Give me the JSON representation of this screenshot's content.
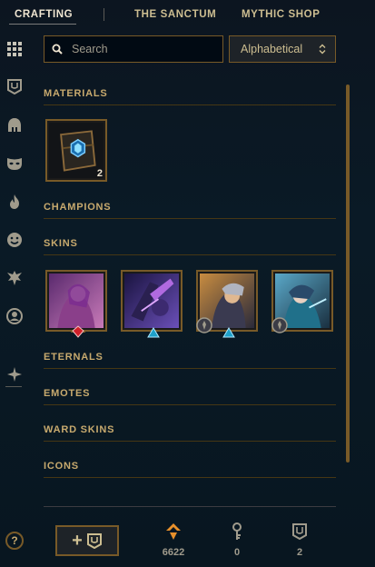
{
  "nav": {
    "tabs": [
      {
        "label": "CRAFTING",
        "active": true
      },
      {
        "label": "THE SANCTUM",
        "active": false
      },
      {
        "label": "MYTHIC SHOP",
        "active": false
      }
    ]
  },
  "sidebar": {
    "icons": [
      "grid-icon",
      "chest-icon",
      "helmet-icon",
      "mask-icon",
      "flame-icon",
      "emote-face-icon",
      "ward-icon",
      "profile-icon",
      "eternals-icon"
    ]
  },
  "search": {
    "placeholder": "Search",
    "value": ""
  },
  "sort": {
    "selected": "Alphabetical"
  },
  "sections": {
    "materials": "MATERIALS",
    "champions": "CHAMPIONS",
    "skins": "SKINS",
    "eternals": "ETERNALS",
    "emotes": "EMOTES",
    "ward_skins": "WARD SKINS",
    "icons": "ICONS"
  },
  "materials": [
    {
      "name": "hextech-chest",
      "count": "2"
    }
  ],
  "skins": [
    {
      "name": "skin-1",
      "badge": "ruby-gem"
    },
    {
      "name": "skin-2",
      "badge": "blue-triangle"
    },
    {
      "name": "skin-3",
      "badge": "blue-triangle",
      "has_emblem": true
    },
    {
      "name": "skin-4",
      "badge": "",
      "has_emblem": true
    }
  ],
  "footer": {
    "help_label": "?",
    "currencies": [
      {
        "icon": "orange-essence-icon",
        "value": "6622",
        "color": "#e8902b"
      },
      {
        "icon": "key-icon",
        "value": "0",
        "color": "#a09b8c"
      },
      {
        "icon": "chest-icon",
        "value": "2",
        "color": "#a09b8c"
      }
    ]
  },
  "colors": {
    "gold": "#c8aa6e",
    "gold_dark": "#785a28",
    "bg": "#0a1a26"
  }
}
